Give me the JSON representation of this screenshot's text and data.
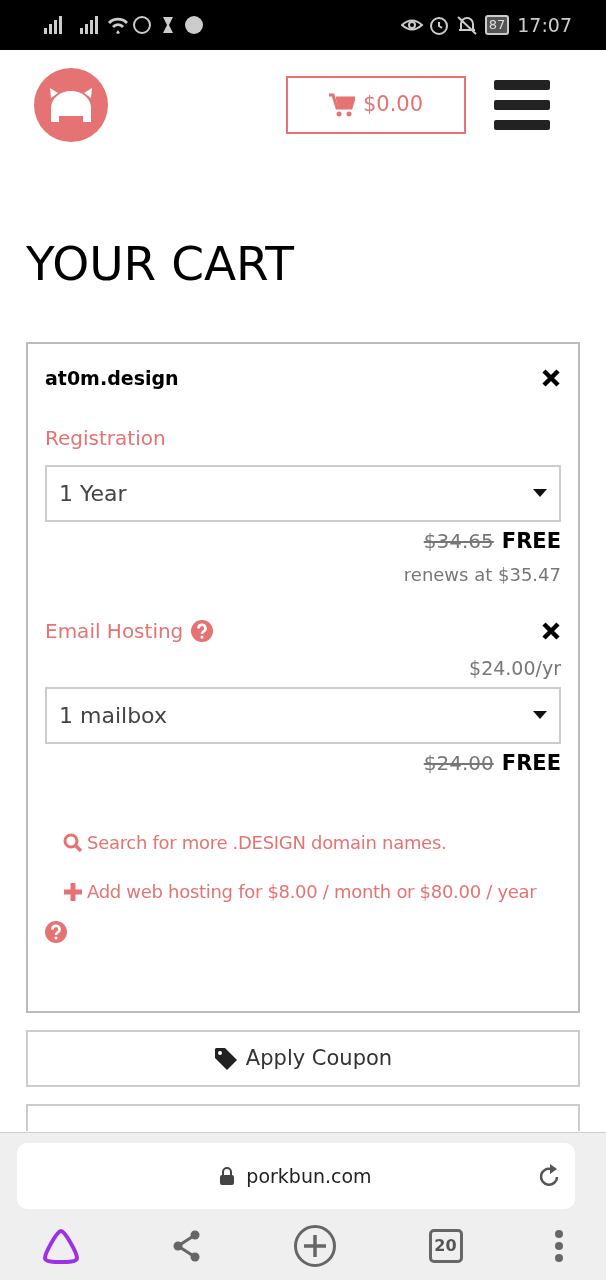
{
  "status_bar": {
    "battery": "87",
    "time": "17:07"
  },
  "header": {
    "cart_total": "$0.00"
  },
  "title": "YOUR CART",
  "cart_item": {
    "domain": "at0m.design",
    "registration": {
      "label": "Registration",
      "value": "1 Year",
      "old_price": "$34.65",
      "price": "FREE",
      "renewal": "renews at $35.47"
    },
    "email_hosting": {
      "label": "Email Hosting",
      "annual_price": "$24.00/yr",
      "value": "1 mailbox",
      "old_price": "$24.00",
      "price": "FREE"
    },
    "links": [
      {
        "kind": "search",
        "text": "Search for more .DESIGN domain names."
      },
      {
        "kind": "add",
        "text": "Add web hosting for $8.00 / month or $80.00 / year"
      }
    ]
  },
  "buttons": [
    {
      "kind": "coupon",
      "label": "Apply Coupon"
    }
  ],
  "browser": {
    "url": "porkbun.com",
    "tab_count": "20"
  }
}
